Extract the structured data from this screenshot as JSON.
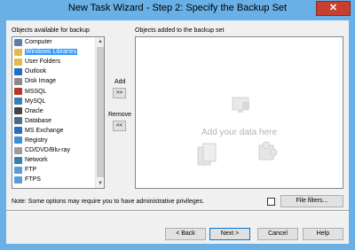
{
  "window": {
    "title": "New Task Wizard - Step 2: Specify the Backup Set",
    "close_glyph": "✕"
  },
  "left_panel": {
    "label": "Objects available for backup",
    "items": [
      {
        "label": "Computer",
        "icon": "computer-icon",
        "selected": false
      },
      {
        "label": "Windows Libraries",
        "icon": "libraries-icon",
        "selected": true
      },
      {
        "label": "User Folders",
        "icon": "user-folder-icon",
        "selected": false
      },
      {
        "label": "Outlook",
        "icon": "outlook-icon",
        "selected": false
      },
      {
        "label": "Disk Image",
        "icon": "disk-image-icon",
        "selected": false
      },
      {
        "label": "MSSQL",
        "icon": "mssql-icon",
        "selected": false
      },
      {
        "label": "MySQL",
        "icon": "mysql-icon",
        "selected": false
      },
      {
        "label": "Oracle",
        "icon": "oracle-icon",
        "selected": false
      },
      {
        "label": "Database",
        "icon": "database-icon",
        "selected": false
      },
      {
        "label": "MS Exchange",
        "icon": "exchange-icon",
        "selected": false
      },
      {
        "label": "Registry",
        "icon": "registry-icon",
        "selected": false
      },
      {
        "label": "CD/DVD/Blu-ray",
        "icon": "disc-icon",
        "selected": false
      },
      {
        "label": "Network",
        "icon": "network-icon",
        "selected": false
      },
      {
        "label": "FTP",
        "icon": "ftp-icon",
        "selected": false
      },
      {
        "label": "FTPS",
        "icon": "ftps-icon",
        "selected": false
      }
    ]
  },
  "add": {
    "label": "Add",
    "button": ">>"
  },
  "remove": {
    "label": "Remove",
    "button": "<<"
  },
  "right_panel": {
    "label": "Objects added to the backup set",
    "placeholder": "Add your data here"
  },
  "note": "Note: Some options may require you to have administrative privileges.",
  "file_filters_button": "File filters...",
  "buttons": {
    "back": "< Back",
    "next": "Next >",
    "cancel": "Cancel",
    "help": "Help"
  },
  "colors": {
    "titlebar": "#68b0e6",
    "close": "#c7402f",
    "selection": "#3399ff",
    "placeholder": "#b4b4b4"
  }
}
